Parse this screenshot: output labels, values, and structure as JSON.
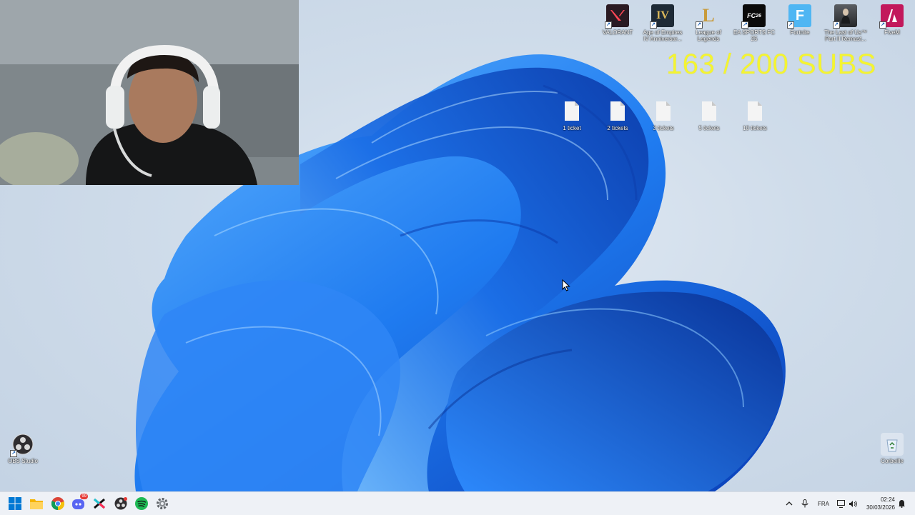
{
  "overlay": {
    "subs_counter": "163 / 200  SUBS",
    "subs_color": "#f4f431"
  },
  "desktop_icons_top": [
    {
      "label": "VALORANT",
      "icon": "valorant-icon",
      "color": "#2a1a22"
    },
    {
      "label": "Age of Empires IV Anniversar...",
      "icon": "age-of-empires-icon",
      "color": "#1e2a36"
    },
    {
      "label": "League of Legends",
      "icon": "league-of-legends-icon",
      "color": "#c89b3c"
    },
    {
      "label": "EA SPORTS FC 25",
      "icon": "ea-fc-icon",
      "color": "#0a0a0a"
    },
    {
      "label": "Fortnite",
      "icon": "fortnite-icon",
      "color": "#4fb6f3"
    },
    {
      "label": "The Last of Us™ Part II Remast...",
      "icon": "last-of-us-icon",
      "color": "#3a3c40"
    },
    {
      "label": "FiveM",
      "icon": "fivem-icon",
      "color": "#c2185b"
    }
  ],
  "ticket_files": [
    {
      "label": "1 ticket"
    },
    {
      "label": "2 tickets"
    },
    {
      "label": "3 tickets"
    },
    {
      "label": "5 tickets"
    },
    {
      "label": "10 tickets"
    }
  ],
  "desktop_icons_bottom": {
    "obs": {
      "label": "OBS Studio",
      "icon": "obs-icon"
    },
    "bin": {
      "label": "Corbeille",
      "icon": "recycle-bin-icon"
    }
  },
  "taskbar": {
    "apps": [
      {
        "name": "start",
        "icon": "windows-start-icon"
      },
      {
        "name": "explorer",
        "icon": "file-explorer-icon"
      },
      {
        "name": "chrome",
        "icon": "chrome-icon"
      },
      {
        "name": "discord",
        "icon": "discord-icon",
        "badge": "99"
      },
      {
        "name": "capcut",
        "icon": "capcut-icon"
      },
      {
        "name": "obs",
        "icon": "obs-taskbar-icon"
      },
      {
        "name": "spotify",
        "icon": "spotify-icon"
      },
      {
        "name": "settings",
        "icon": "settings-icon"
      }
    ],
    "language": "FRA",
    "time": "02:24",
    "date": "30/03/2026"
  }
}
